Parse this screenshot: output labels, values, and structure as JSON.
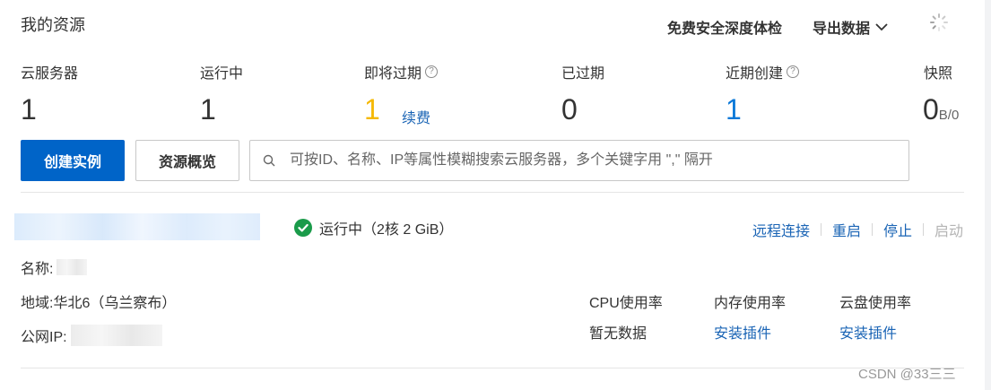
{
  "header": {
    "title": "我的资源",
    "security_check": "免费安全深度体检",
    "export": "导出数据"
  },
  "stats": {
    "servers_label": "云服务器",
    "servers_value": "1",
    "running_label": "运行中",
    "running_value": "1",
    "expiring_label": "即将过期",
    "expiring_value": "1",
    "renew": "续费",
    "expired_label": "已过期",
    "expired_value": "0",
    "recent_label": "近期创建",
    "recent_value": "1",
    "snapshot_label": "快照",
    "snapshot_value": "0",
    "snapshot_unit": "B/0"
  },
  "toolbar": {
    "create_label": "创建实例",
    "overview_label": "资源概览",
    "search_placeholder": "可按ID、名称、IP等属性模糊搜索云服务器，多个关键字用 \",\" 隔开"
  },
  "instance": {
    "status_text": "运行中（2核 2 GiB）",
    "actions": {
      "remote": "远程连接",
      "restart": "重启",
      "stop": "停止",
      "start": "启动"
    },
    "name_label": "名称:",
    "region_label": "地域:",
    "region_value": "华北6（乌兰察布）",
    "ip_label": "公网IP:",
    "metrics": {
      "cpu_label": "CPU使用率",
      "cpu_value": "暂无数据",
      "mem_label": "内存使用率",
      "mem_value": "安装插件",
      "disk_label": "云盘使用率",
      "disk_value": "安装插件"
    }
  },
  "watermark": "CSDN @33三三",
  "colors": {
    "primary": "#0064c8",
    "link": "#1a64b5",
    "expiring": "#f5b800",
    "recent": "#0a78d8",
    "success": "#1a9b4a"
  },
  "icons": {
    "help": "question-circle-icon",
    "dropdown": "chevron-down-icon",
    "search": "search-icon",
    "status": "check-circle-icon",
    "loading": "spinner-icon"
  }
}
